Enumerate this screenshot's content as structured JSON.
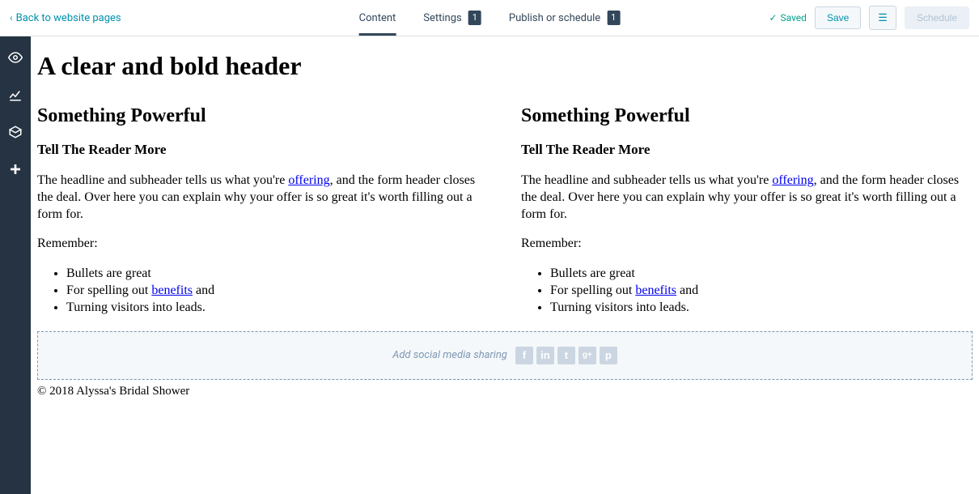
{
  "topbar": {
    "back_label": "Back to website pages",
    "tabs": {
      "content": "Content",
      "settings": "Settings",
      "settings_badge": "1",
      "publish": "Publish or schedule",
      "publish_badge": "1"
    },
    "saved_label": "Saved",
    "save_button": "Save",
    "schedule_button": "Schedule"
  },
  "page": {
    "header": "A clear and bold header",
    "col1": {
      "heading": "Something Powerful",
      "subheading": "Tell The Reader More",
      "para_pre": "The headline and subheader tells us what you're ",
      "para_link": "offering",
      "para_post": ", and the form header closes the deal. Over here you can explain why your offer is so great it's worth filling out a form for.",
      "remember": "Remember:",
      "bullets": {
        "b1": "Bullets are great",
        "b2_pre": "For spelling out ",
        "b2_link": "benefits",
        "b2_post": " and",
        "b3": "Turning visitors into leads."
      }
    },
    "col2": {
      "heading": "Something Powerful",
      "subheading": "Tell The Reader More",
      "para_pre": "The headline and subheader tells us what you're ",
      "para_link": "offering",
      "para_post": ", and the form header closes the deal. Over here you can explain why your offer is so great it's worth filling out a form for.",
      "remember": "Remember:",
      "bullets": {
        "b1": "Bullets are great",
        "b2_pre": "For spelling out ",
        "b2_link": "benefits",
        "b2_post": " and",
        "b3": "Turning visitors into leads."
      }
    },
    "social_label": "Add social media sharing",
    "social_icons": {
      "fb": "f",
      "in": "in",
      "tw": "t",
      "gp": "g+",
      "pn": "p"
    },
    "footer": "© 2018 Alyssa's Bridal Shower"
  }
}
